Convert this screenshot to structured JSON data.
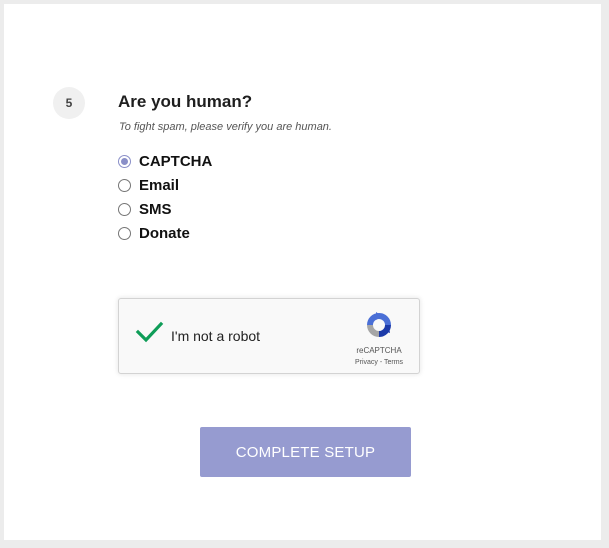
{
  "step": {
    "number": "5",
    "title": "Are you human?",
    "subtitle": "To fight spam, please verify you are human."
  },
  "verification_options": [
    {
      "label": "CAPTCHA",
      "selected": true
    },
    {
      "label": "Email",
      "selected": false
    },
    {
      "label": "SMS",
      "selected": false
    },
    {
      "label": "Donate",
      "selected": false
    }
  ],
  "recaptcha": {
    "checkbox_label": "I'm not a robot",
    "checked": true,
    "brand": "reCAPTCHA",
    "privacy_link": "Privacy",
    "separator": " - ",
    "terms_link": "Terms",
    "check_icon": "checkmark-icon",
    "logo_icon": "recaptcha-logo-icon",
    "colors": {
      "check": "#0f9d58",
      "logo_blue": "#4a6fd6",
      "logo_grey": "#a6a6a6",
      "logo_navy": "#1c3aa9"
    }
  },
  "submit": {
    "label": "COMPLETE SETUP"
  },
  "colors": {
    "accent": "#969bd0",
    "page_background": "#ececec",
    "card_background": "#ffffff"
  }
}
